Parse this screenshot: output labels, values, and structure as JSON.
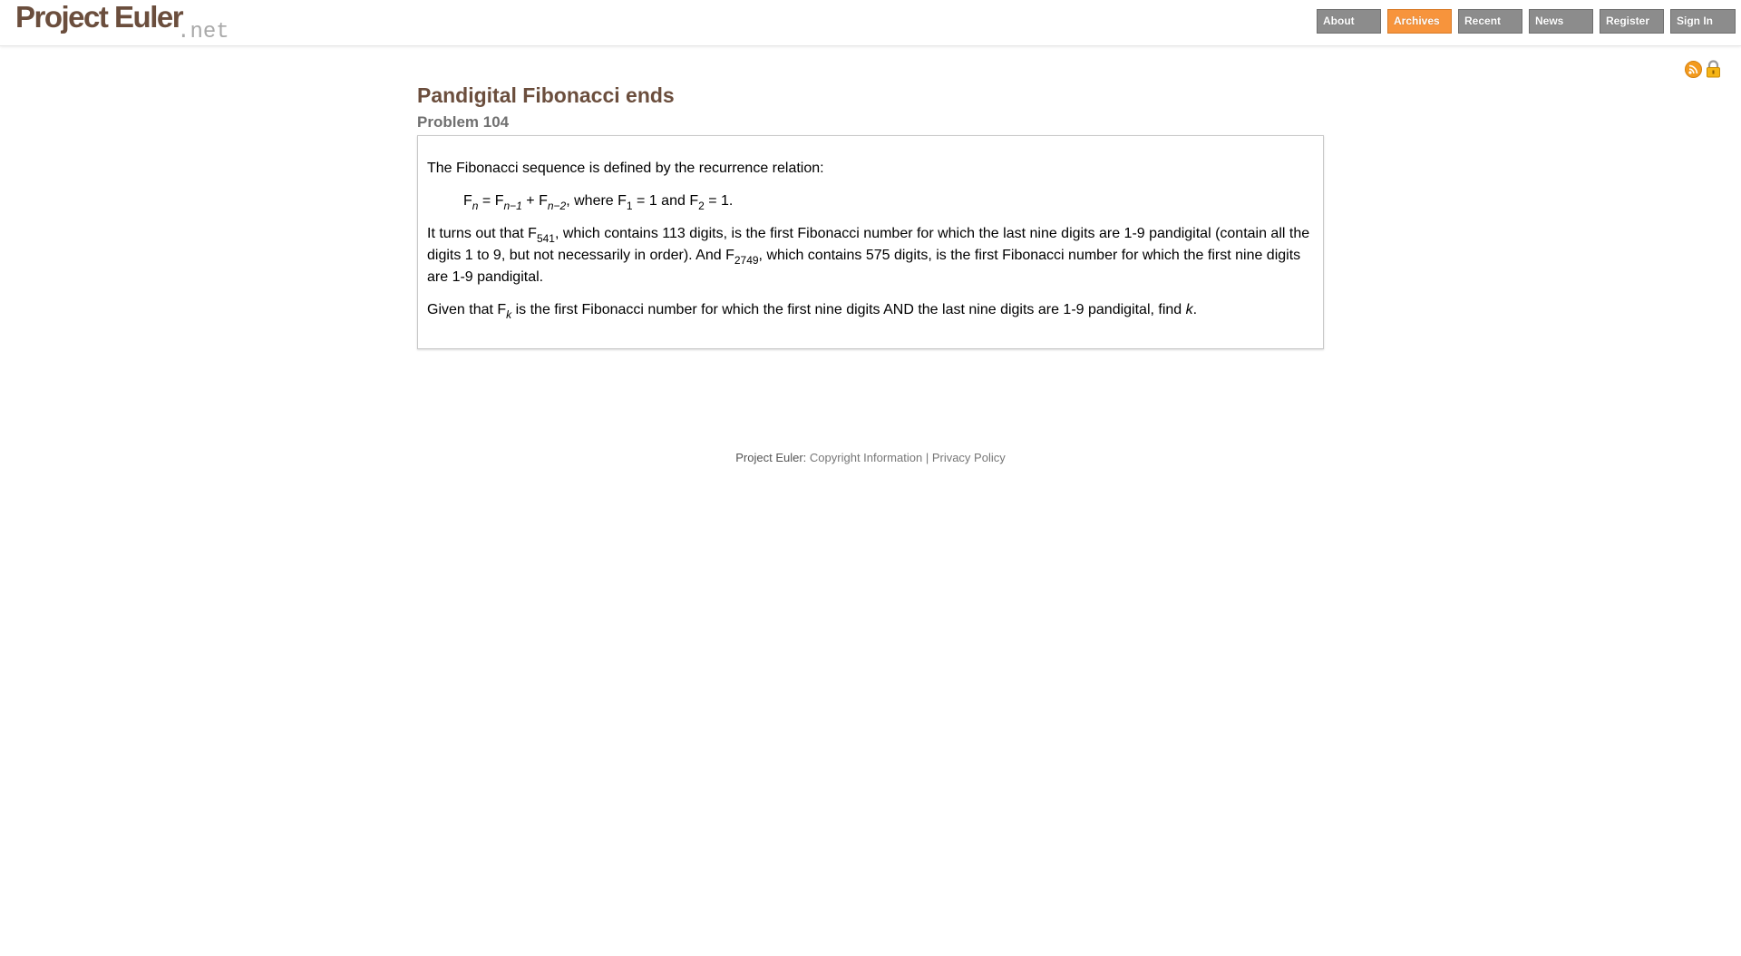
{
  "header": {
    "logo_main": "Project Euler",
    "logo_suffix": ".net",
    "nav": [
      {
        "label": "About",
        "active": false
      },
      {
        "label": "Archives",
        "active": true
      },
      {
        "label": "Recent",
        "active": false
      },
      {
        "label": "News",
        "active": false
      },
      {
        "label": "Register",
        "active": false
      },
      {
        "label": "Sign In",
        "active": false
      }
    ],
    "icons": [
      "rss-icon",
      "lock-icon"
    ]
  },
  "problem": {
    "title": "Pandigital Fibonacci ends",
    "number": "Problem 104",
    "p1": "The Fibonacci sequence is defined by the recurrence relation:",
    "formula": {
      "F": "F",
      "n": "n",
      "eq": " = F",
      "n1": "n−1",
      "plus": " + F",
      "n2": "n−2",
      "where": ", where F",
      "one": "1",
      "eq1and": " = 1 and F",
      "two": "2",
      "eq1end": " = 1."
    },
    "p2": {
      "a": "It turns out that F",
      "sub541": "541",
      "b": ", which contains 113 digits, is the first Fibonacci number for which the last nine digits are 1-9 pandigital (contain all the digits 1 to 9, but not necessarily in order). And F",
      "sub2749": "2749",
      "c": ", which contains 575 digits, is the first Fibonacci number for which the first nine digits are 1-9 pandigital."
    },
    "p3": {
      "a": "Given that F",
      "subk": "k",
      "b": " is the first Fibonacci number for which the first nine digits AND the last nine digits are 1-9 pandigital, find ",
      "k": "k",
      "c": "."
    }
  },
  "footer": {
    "prefix": "Project Euler: ",
    "copyright": "Copyright Information",
    "separator": " | ",
    "privacy": "Privacy Policy"
  },
  "colors": {
    "brand": "#6b4e3d",
    "nav_active": "#f7943c",
    "nav_inactive": "#8c8c8c"
  }
}
